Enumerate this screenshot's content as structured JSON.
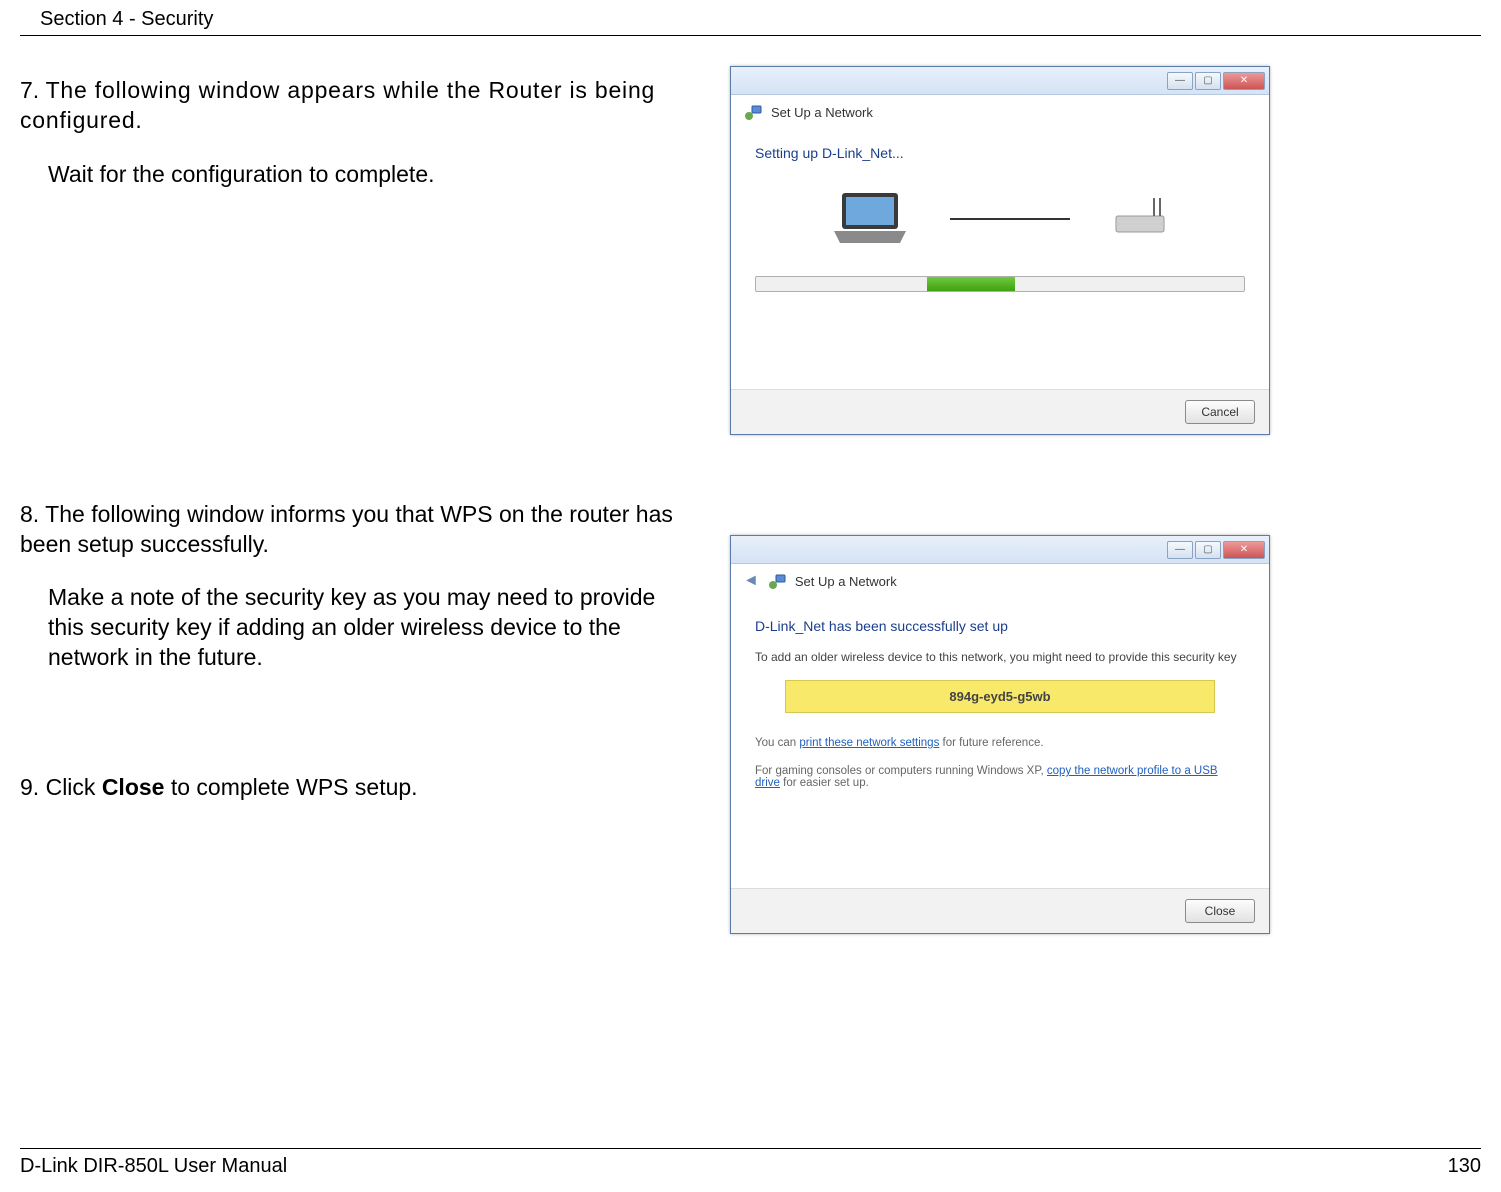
{
  "header": "Section 4 - Security",
  "step7": {
    "num": "7.",
    "text": "The following window appears while the Router is being configured.",
    "body": "Wait for the configuration to complete."
  },
  "step8": {
    "num": "8.",
    "text": "The following window informs you that WPS on the router has been setup successfully.",
    "body": "Make a note of the security key as you may need to provide this security key if adding an older wireless device to the network in the future."
  },
  "step9": {
    "num": "9.",
    "pre": "Click ",
    "bold": "Close",
    "post": " to complete WPS setup."
  },
  "win1": {
    "title": "Set Up a Network",
    "status": "Setting up D-Link_Net...",
    "cancel": "Cancel"
  },
  "win2": {
    "title": "Set Up a Network",
    "success": "D-Link_Net has been successfully set up",
    "info": "To add an older wireless device to this network, you might need to provide this security key",
    "key": "894g-eyd5-g5wb",
    "youcan_pre": "You can ",
    "youcan_link": "print these network settings",
    "youcan_post": " for future reference.",
    "gaming_pre": "For gaming consoles or computers running Windows XP, ",
    "gaming_link": "copy the network profile to a USB drive",
    "gaming_post": " for easier set up.",
    "close": "Close"
  },
  "footer": {
    "manual": "D-Link DIR-850L User Manual",
    "page": "130"
  }
}
